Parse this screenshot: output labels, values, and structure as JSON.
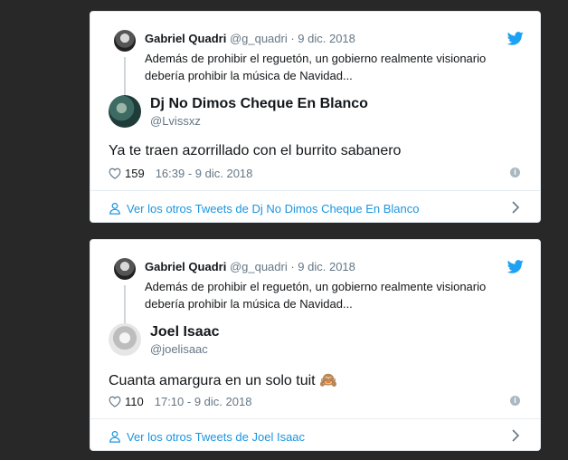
{
  "tweets": [
    {
      "parent": {
        "name": "Gabriel Quadri",
        "meta": "@g_quadri · 9 dic. 2018",
        "text": "Además de prohibir el reguetón, un gobierno realmente visionario debería prohibir la música de Navidad..."
      },
      "reply": {
        "name": "Dj No Dimos Cheque En Blanco",
        "handle": "@Lvissxz",
        "text": "Ya te traen azorrillado con el burrito sabanero",
        "likes": "159",
        "timestamp": "16:39 - 9 dic. 2018"
      },
      "footer_link": "Ver los otros Tweets de Dj No Dimos Cheque En Blanco"
    },
    {
      "parent": {
        "name": "Gabriel Quadri",
        "meta": "@g_quadri · 9 dic. 2018",
        "text": "Además de prohibir el reguetón, un gobierno realmente visionario debería prohibir la música de Navidad..."
      },
      "reply": {
        "name": "Joel Isaac",
        "handle": "@joelisaac",
        "text": "Cuanta amargura en un solo tuit 🙈",
        "likes": "110",
        "timestamp": "17:10 - 9 dic. 2018"
      },
      "footer_link": "Ver los otros Tweets de Joel Isaac"
    }
  ],
  "colors": {
    "background": "#282828",
    "link": "#1b95e0",
    "twitter_blue": "#1da1f2",
    "muted": "#657786"
  },
  "icons": {
    "brand": "twitter-bird-icon",
    "like": "heart-icon",
    "info": "info-icon",
    "user": "user-icon",
    "chevron": "chevron-right-icon"
  }
}
